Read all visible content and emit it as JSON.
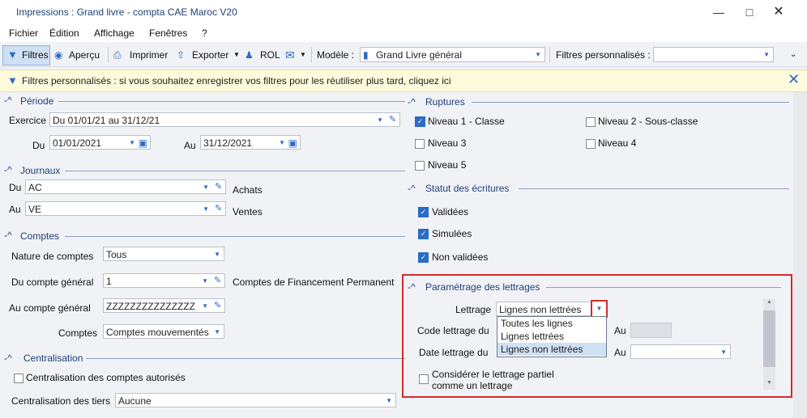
{
  "window": {
    "title": "Impressions : Grand livre - compta CAE Maroc V20"
  },
  "menu": [
    "Fichier",
    "Édition",
    "Affichage",
    "Fenêtres",
    "?"
  ],
  "toolbar": {
    "filtres": "Filtres",
    "apercu": "Aperçu",
    "imprimer": "Imprimer",
    "exporter": "Exporter",
    "rol": "ROL",
    "modele_label": "Modèle :",
    "modele_value": "Grand Livre général",
    "filtres_perso_label": "Filtres personnalisés :",
    "filtres_perso_value": ""
  },
  "info": {
    "text": "Filtres personnalisés : si vous souhaitez enregistrer vos filtres pour les réutiliser plus tard, cliquez ici"
  },
  "periode": {
    "title": "Période",
    "exercice_label": "Exercice",
    "exercice_value": "Du 01/01/21 au 31/12/21",
    "du_label": "Du",
    "du_value": "01/01/2021",
    "au_label": "Au",
    "au_value": "31/12/2021"
  },
  "journaux": {
    "title": "Journaux",
    "du_label": "Du",
    "du_value": "AC",
    "du_desc": "Achats",
    "au_label": "Au",
    "au_value": "VE",
    "au_desc": "Ventes"
  },
  "comptes": {
    "title": "Comptes",
    "nature_label": "Nature de comptes",
    "nature_value": "Tous",
    "du_label": "Du compte général",
    "du_value": "1",
    "du_desc": "Comptes de Financement Permanent",
    "au_label": "Au compte général",
    "au_value": "ZZZZZZZZZZZZZZZ",
    "comptes_label": "Comptes",
    "comptes_value": "Comptes mouvementés"
  },
  "centralisation": {
    "title": "Centralisation",
    "cb_label": "Centralisation des comptes autorisés",
    "tiers_label": "Centralisation des tiers",
    "tiers_value": "Aucune"
  },
  "ruptures": {
    "title": "Ruptures",
    "items": [
      {
        "label": "Niveau 1 - Classe",
        "checked": true
      },
      {
        "label": "Niveau 2 - Sous-classe",
        "checked": false
      },
      {
        "label": "Niveau 3",
        "checked": false
      },
      {
        "label": "Niveau 4",
        "checked": false
      },
      {
        "label": "Niveau 5",
        "checked": false
      }
    ]
  },
  "statut": {
    "title": "Statut des écritures",
    "items": [
      {
        "label": "Validées",
        "checked": true
      },
      {
        "label": "Simulées",
        "checked": true
      },
      {
        "label": "Non validées",
        "checked": true
      }
    ]
  },
  "lettrage": {
    "title": "Paramétrage des lettrages",
    "lettrage_label": "Lettrage",
    "lettrage_value": "Lignes non lettrées",
    "code_label": "Code lettrage du",
    "date_label": "Date lettrage du",
    "au_label": "Au",
    "au_label2": "Au",
    "options": [
      "Toutes les lignes",
      "Lignes lettrées",
      "Lignes non lettrées"
    ],
    "partial_label_1": "Considérer le lettrage partiel",
    "partial_label_2": "comme un lettrage"
  },
  "colors": {
    "accent": "#2b6cc4",
    "highlight": "#d42a2a"
  }
}
